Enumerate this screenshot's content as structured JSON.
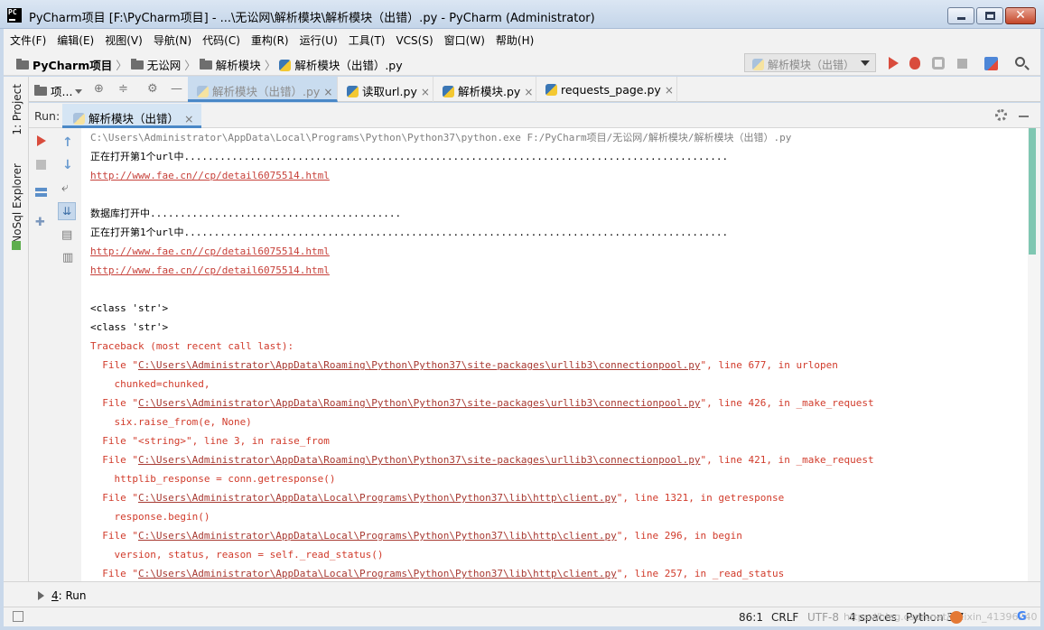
{
  "window": {
    "title": "PyCharm项目 [F:\\PyCharm项目] - ...\\无讼网\\解析模块\\解析模块（出错）.py - PyCharm (Administrator)",
    "app_icon": "PC"
  },
  "menu": [
    "文件(F)",
    "编辑(E)",
    "视图(V)",
    "导航(N)",
    "代码(C)",
    "重构(R)",
    "运行(U)",
    "工具(T)",
    "VCS(S)",
    "窗口(W)",
    "帮助(H)"
  ],
  "breadcrumb": [
    "PyCharm项目",
    "无讼网",
    "解析模块",
    "解析模块（出错）.py"
  ],
  "run_config": "解析模块（出错）",
  "left_tool_tabs": {
    "project": "1: Project",
    "nosql": "NoSql Explorer"
  },
  "project_header": "项...",
  "editor_tabs": [
    {
      "label": "解析模块（出错）.py",
      "active": true
    },
    {
      "label": "读取url.py",
      "active": false
    },
    {
      "label": "解析模块.py",
      "active": false
    },
    {
      "label": "requests_page.py",
      "active": false
    }
  ],
  "close_glyph": "×",
  "run_panel": {
    "label": "Run:",
    "tab": "解析模块（出错）"
  },
  "console": [
    {
      "style": "gray",
      "text": "C:\\Users\\Administrator\\AppData\\Local\\Programs\\Python\\Python37\\python.exe F:/PyCharm项目/无讼网/解析模块/解析模块（出错）.py"
    },
    {
      "style": "black",
      "text": "正在打开第1个url中..........................................................................................."
    },
    {
      "style": "link",
      "text": "http://www.fae.cn//cp/detail6075514.html"
    },
    {
      "style": "black",
      "text": ""
    },
    {
      "style": "black",
      "text": "数据库打开中.........................................."
    },
    {
      "style": "black",
      "text": "正在打开第1个url中..........................................................................................."
    },
    {
      "style": "link",
      "text": "http://www.fae.cn//cp/detail6075514.html"
    },
    {
      "style": "link",
      "text": "http://www.fae.cn//cp/detail6075514.html"
    },
    {
      "style": "black",
      "text": ""
    },
    {
      "style": "black",
      "text": "<class 'str'>"
    },
    {
      "style": "black",
      "text": "<class 'str'>"
    },
    {
      "style": "err",
      "text": "Traceback (most recent call last):"
    },
    {
      "style": "trace",
      "pre": "  File \"",
      "link": "C:\\Users\\Administrator\\AppData\\Roaming\\Python\\Python37\\site-packages\\urllib3\\connectionpool.py",
      "post": "\", line 677, in urlopen"
    },
    {
      "style": "err",
      "text": "    chunked=chunked,"
    },
    {
      "style": "trace",
      "pre": "  File \"",
      "link": "C:\\Users\\Administrator\\AppData\\Roaming\\Python\\Python37\\site-packages\\urllib3\\connectionpool.py",
      "post": "\", line 426, in _make_request"
    },
    {
      "style": "err",
      "text": "    six.raise_from(e, None)"
    },
    {
      "style": "err",
      "text": "  File \"<string>\", line 3, in raise_from"
    },
    {
      "style": "trace",
      "pre": "  File \"",
      "link": "C:\\Users\\Administrator\\AppData\\Roaming\\Python\\Python37\\site-packages\\urllib3\\connectionpool.py",
      "post": "\", line 421, in _make_request"
    },
    {
      "style": "err",
      "text": "    httplib_response = conn.getresponse()"
    },
    {
      "style": "trace",
      "pre": "  File \"",
      "link": "C:\\Users\\Administrator\\AppData\\Local\\Programs\\Python\\Python37\\lib\\http\\client.py",
      "post": "\", line 1321, in getresponse"
    },
    {
      "style": "err",
      "text": "    response.begin()"
    },
    {
      "style": "trace",
      "pre": "  File \"",
      "link": "C:\\Users\\Administrator\\AppData\\Local\\Programs\\Python\\Python37\\lib\\http\\client.py",
      "post": "\", line 296, in begin"
    },
    {
      "style": "err",
      "text": "    version, status, reason = self._read_status()"
    },
    {
      "style": "trace",
      "pre": "  File \"",
      "link": "C:\\Users\\Administrator\\AppData\\Local\\Programs\\Python\\Python37\\lib\\http\\client.py",
      "post": "\", line 257, in _read_status"
    }
  ],
  "bottom_tab": {
    "number": "4",
    "label": ": Run"
  },
  "status": {
    "position": "86:1",
    "line_sep": "CRLF",
    "encoding": "UTF-8",
    "indent": "4 spaces",
    "interpreter": "Python 3.7",
    "watermark": "https://blog.csdn.net/weixin_41396240"
  },
  "colors": {
    "accent": "#4a88c7",
    "error": "#d13b2b",
    "run": "#d94c3d",
    "scroll": "#7fc7b2"
  }
}
